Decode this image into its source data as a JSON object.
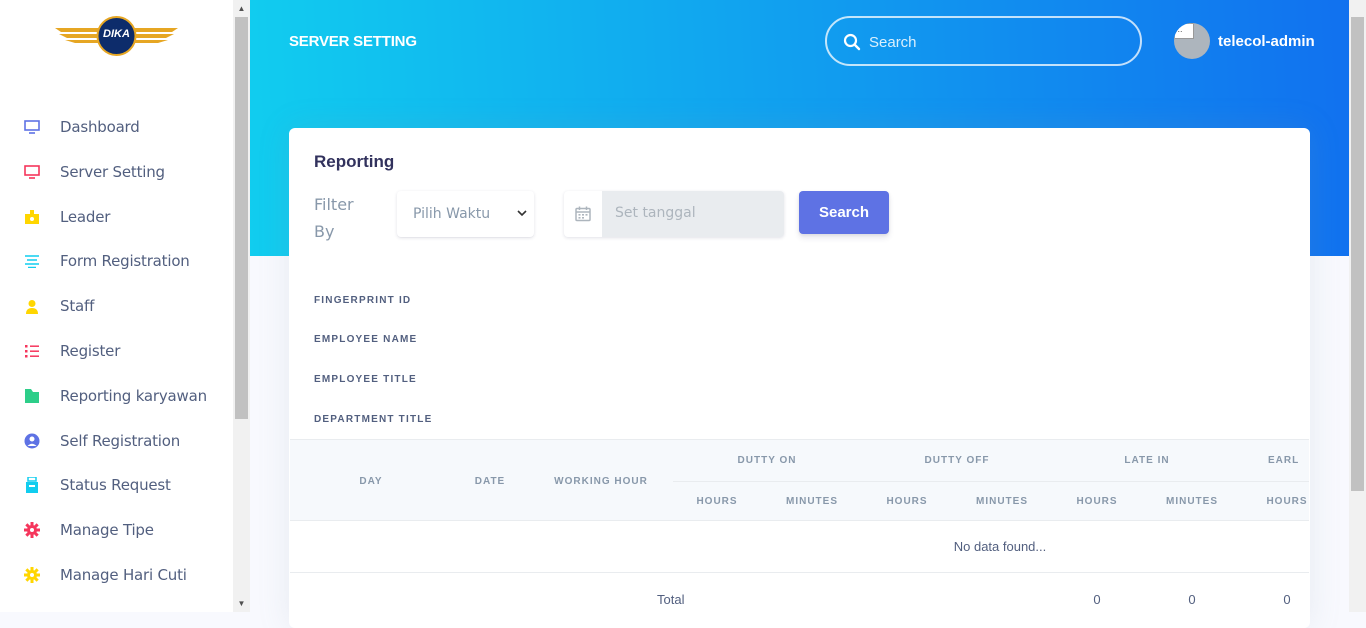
{
  "brand": {
    "logo_text": "DIKA"
  },
  "sidebar": {
    "items": [
      {
        "label": "Dashboard",
        "icon": "monitor-icon",
        "color": "#5e72e4"
      },
      {
        "label": "Server Setting",
        "icon": "monitor-icon",
        "color": "#f5365c"
      },
      {
        "label": "Leader",
        "icon": "badge-icon",
        "color": "#ffd600"
      },
      {
        "label": "Form Registration",
        "icon": "align-center-icon",
        "color": "#11cdef"
      },
      {
        "label": "Staff",
        "icon": "user-icon",
        "color": "#ffd600"
      },
      {
        "label": "Register",
        "icon": "list-icon",
        "color": "#f5365c"
      },
      {
        "label": "Reporting karyawan",
        "icon": "folder-icon",
        "color": "#2dce89"
      },
      {
        "label": "Self Registration",
        "icon": "user-circle-icon",
        "color": "#5e72e4"
      },
      {
        "label": "Status Request",
        "icon": "archive-icon",
        "color": "#11cdef"
      },
      {
        "label": "Manage Tipe",
        "icon": "gear-icon",
        "color": "#f5365c"
      },
      {
        "label": "Manage Hari Cuti",
        "icon": "gear-icon",
        "color": "#ffd600"
      }
    ]
  },
  "header": {
    "title": "SERVER SETTING",
    "search_placeholder": "Search",
    "username": "telecol-admin",
    "avatar_alt": "..."
  },
  "card": {
    "title": "Reporting",
    "filter_label": "Filter By",
    "select_value": "Pilih Waktu",
    "date_placeholder": "Set tanggal",
    "search_button": "Search",
    "info_labels": [
      "FINGERPRINT ID",
      "EMPLOYEE NAME",
      "EMPLOYEE TITLE",
      "DEPARTMENT TITLE"
    ]
  },
  "table": {
    "columns": [
      "DAY",
      "DATE",
      "WORKING HOUR"
    ],
    "groups": [
      "DUTTY ON",
      "DUTTY OFF",
      "LATE IN",
      "EARL"
    ],
    "sub_columns": [
      "HOURS",
      "MINUTES",
      "HOURS",
      "MINUTES",
      "HOURS",
      "MINUTES",
      "HOURS"
    ],
    "empty_text": "No data found...",
    "total_label": "Total",
    "totals": [
      "0",
      "0",
      "0"
    ]
  }
}
